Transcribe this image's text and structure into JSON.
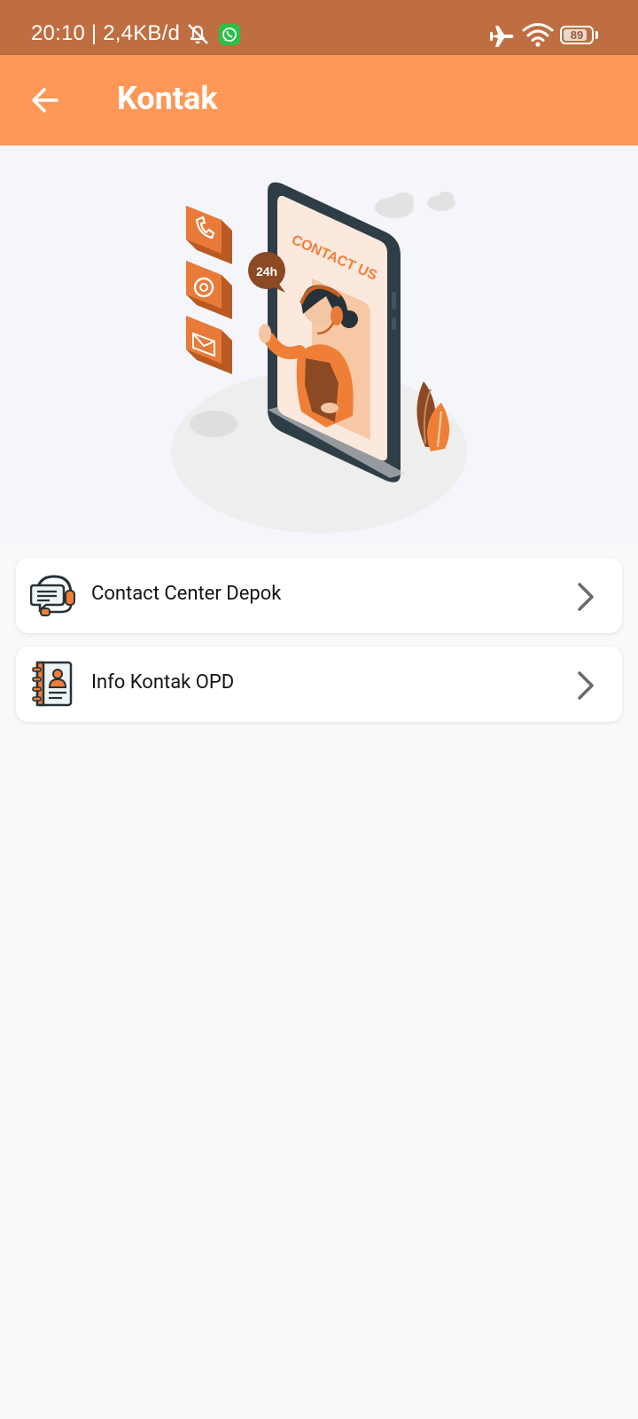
{
  "status_bar": {
    "time_and_speed": "20:10 | 2,4KB/d",
    "battery": "89",
    "battery_fraction": 0.89
  },
  "app_bar": {
    "title": "Kontak",
    "back_icon": "arrow-left-icon"
  },
  "hero": {
    "badge_text": "24h",
    "screen_text": "CONTACT US"
  },
  "menu": {
    "items": [
      {
        "label": "Contact Center Depok",
        "icon": "headset-chat-icon"
      },
      {
        "label": "Info Kontak OPD",
        "icon": "contact-book-icon"
      }
    ]
  },
  "colors": {
    "status_bar": "#bf6e42",
    "app_bar": "#ff9756",
    "accent_dark": "#d9682a",
    "background": "#f9f9f9"
  }
}
